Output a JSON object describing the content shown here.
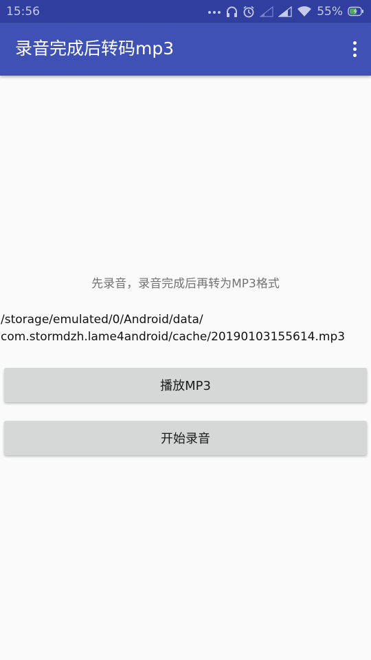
{
  "status_bar": {
    "time": "15:56",
    "battery_percent": "55%",
    "icons": [
      "more-dots-icon",
      "headset-icon",
      "alarm-icon",
      "signal-weak-icon",
      "signal-icon",
      "wifi-icon",
      "battery-charging-icon"
    ]
  },
  "app_bar": {
    "title": "录音完成后转码mp3",
    "overflow_icon": "more-vert-icon"
  },
  "main": {
    "hint": "先录音，录音完成后再转为MP3格式",
    "file_path_line1": "/storage/emulated/0/Android/data/",
    "file_path_line2": "com.stormdzh.lame4android/cache/20190103155614.mp3",
    "play_button_label": "播放MP3",
    "record_button_label": "开始录音"
  },
  "colors": {
    "status_bar": "#303f9f",
    "app_bar": "#3f51b5",
    "background": "#fafafa",
    "button": "#d6d7d7"
  }
}
